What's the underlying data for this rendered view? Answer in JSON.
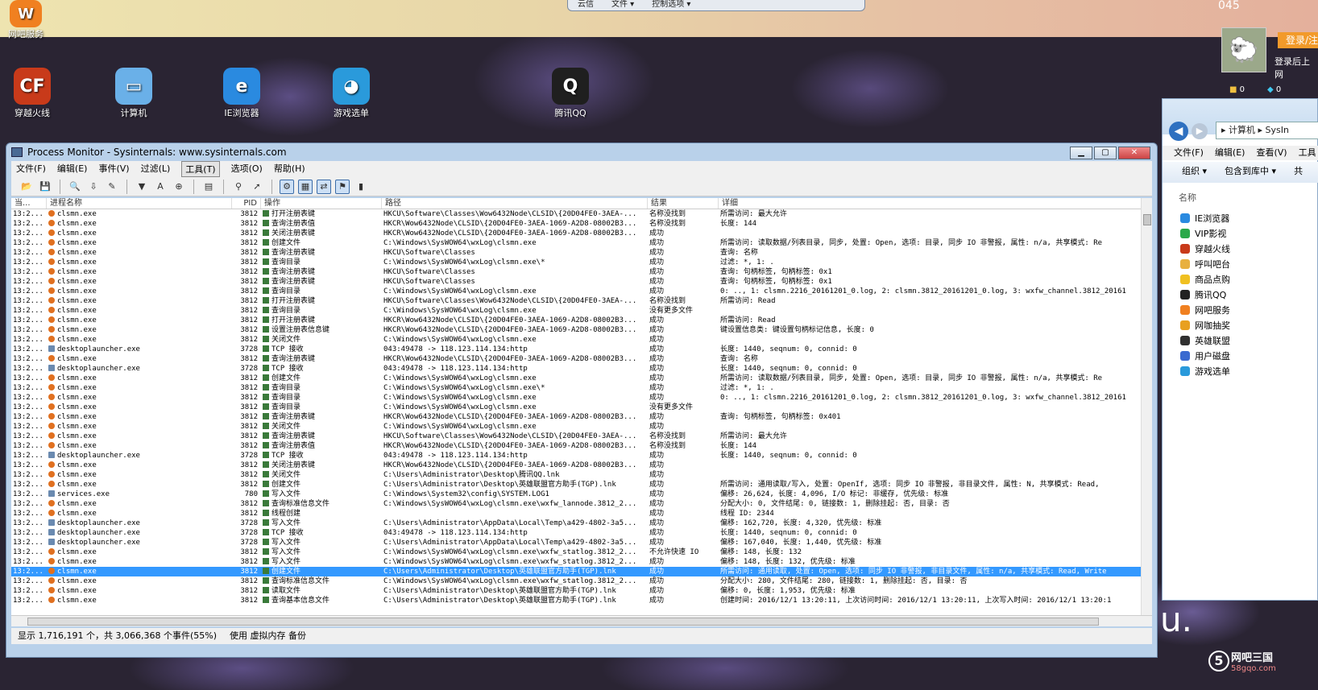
{
  "topbar": {
    "items": [
      "云信",
      "文件 ▾",
      "控制选项 ▾"
    ]
  },
  "clock": "045",
  "desktop": {
    "corner_label": "网吧服务",
    "icons": [
      {
        "label": "穿越火线",
        "icon": "crossfire-icon",
        "color": "#c83a1a",
        "glyph": "CF"
      },
      {
        "label": "计算机",
        "icon": "computer-icon",
        "color": "#6ab0e8",
        "glyph": "▭"
      },
      {
        "label": "IE浏览器",
        "icon": "ie-browser-icon",
        "color": "#2a8ae0",
        "glyph": "e"
      },
      {
        "label": "游戏选单",
        "icon": "game-menu-icon",
        "color": "#2a9adb",
        "glyph": "◕"
      },
      {
        "label": "腾讯QQ",
        "icon": "qq-penguin-icon",
        "color": "#1f1f1f",
        "glyph": "Q"
      }
    ]
  },
  "right_panel": {
    "login": "登录/注",
    "hint": "登录后上网",
    "count1": "0",
    "count2": "0"
  },
  "explorer": {
    "address": "▸ 计算机 ▸ SysIn",
    "menu": [
      "文件(F)",
      "编辑(E)",
      "查看(V)",
      "工具"
    ],
    "toolbar": [
      "组织 ▾",
      "包含到库中 ▾",
      "共"
    ],
    "column": "名称",
    "items": [
      {
        "label": "IE浏览器",
        "color": "#2a8ae0"
      },
      {
        "label": "VIP影视",
        "color": "#2aa84a"
      },
      {
        "label": "穿越火线",
        "color": "#c83a1a"
      },
      {
        "label": "呼叫吧台",
        "color": "#e8b040"
      },
      {
        "label": "商品点购",
        "color": "#f0c020"
      },
      {
        "label": "腾讯QQ",
        "color": "#222222"
      },
      {
        "label": "网吧服务",
        "color": "#f08020"
      },
      {
        "label": "网咖抽奖",
        "color": "#e8a020"
      },
      {
        "label": "英雄联盟",
        "color": "#303030"
      },
      {
        "label": "用户磁盘",
        "color": "#3a6ad0"
      },
      {
        "label": "游戏选单",
        "color": "#2a9adb"
      }
    ]
  },
  "procmon": {
    "title": "Process Monitor - Sysinternals: www.sysinternals.com",
    "menu": [
      "文件(F)",
      "编辑(E)",
      "事件(V)",
      "过滤(L)",
      "工具(T)",
      "选项(O)",
      "帮助(H)"
    ],
    "active_menu_index": 4,
    "toolbar": [
      {
        "name": "open-icon",
        "glyph": "📂"
      },
      {
        "name": "save-icon",
        "glyph": "💾"
      },
      {
        "name": "sep"
      },
      {
        "name": "capture-icon",
        "glyph": "🔍"
      },
      {
        "name": "autoscroll-icon",
        "glyph": "⇩"
      },
      {
        "name": "clear-icon",
        "glyph": "✎"
      },
      {
        "name": "sep"
      },
      {
        "name": "filter-icon",
        "glyph": "▼"
      },
      {
        "name": "highlight-icon",
        "glyph": "A"
      },
      {
        "name": "include-process-icon",
        "glyph": "⊕"
      },
      {
        "name": "sep"
      },
      {
        "name": "process-tree-icon",
        "glyph": "▤"
      },
      {
        "name": "sep"
      },
      {
        "name": "find-icon",
        "glyph": "⚲"
      },
      {
        "name": "jump-icon",
        "glyph": "➚"
      },
      {
        "name": "sep"
      },
      {
        "name": "registry-activity-icon",
        "glyph": "⚙",
        "selected": true
      },
      {
        "name": "file-activity-icon",
        "glyph": "▦",
        "selected": true
      },
      {
        "name": "network-activity-icon",
        "glyph": "⇄",
        "selected": true
      },
      {
        "name": "process-activity-icon",
        "glyph": "⚑",
        "selected": true
      },
      {
        "name": "profiling-icon",
        "glyph": "▮"
      }
    ],
    "columns": [
      "当...",
      "进程名称",
      "PID",
      "操作",
      "路径",
      "结果",
      "详细"
    ],
    "rows": [
      [
        "13:2...",
        "clsmn.exe",
        "3812",
        "打开注册表键",
        "HKCU\\Software\\Classes\\Wow6432Node\\CLSID\\{20D04FE0-3AEA-...",
        "名称没找到",
        "所需访问: 最大允许"
      ],
      [
        "13:2...",
        "clsmn.exe",
        "3812",
        "查询注册表值",
        "HKCR\\Wow6432Node\\CLSID\\{20D04FE0-3AEA-1069-A2D8-08002B3...",
        "名称没找到",
        "长度: 144"
      ],
      [
        "13:2...",
        "clsmn.exe",
        "3812",
        "关闭注册表键",
        "HKCR\\Wow6432Node\\CLSID\\{20D04FE0-3AEA-1069-A2D8-08002B3...",
        "成功",
        ""
      ],
      [
        "13:2...",
        "clsmn.exe",
        "3812",
        "创建文件",
        "C:\\Windows\\SysWOW64\\wxLog\\clsmn.exe",
        "成功",
        "所需访问: 读取数据/列表目录, 同步, 处置: Open, 选项: 目录, 同步 IO 非警报, 属性: n/a, 共享模式: Re"
      ],
      [
        "13:2...",
        "clsmn.exe",
        "3812",
        "查询注册表键",
        "HKCU\\Software\\Classes",
        "成功",
        "查询: 名称"
      ],
      [
        "13:2...",
        "clsmn.exe",
        "3812",
        "查询目录",
        "C:\\Windows\\SysWOW64\\wxLog\\clsmn.exe\\*",
        "成功",
        "过滤: *, 1: ."
      ],
      [
        "13:2...",
        "clsmn.exe",
        "3812",
        "查询注册表键",
        "HKCU\\Software\\Classes",
        "成功",
        "查询: 句柄标签, 句柄标签: 0x1"
      ],
      [
        "13:2...",
        "clsmn.exe",
        "3812",
        "查询注册表键",
        "HKCU\\Software\\Classes",
        "成功",
        "查询: 句柄标签, 句柄标签: 0x1"
      ],
      [
        "13:2...",
        "clsmn.exe",
        "3812",
        "查询目录",
        "C:\\Windows\\SysWOW64\\wxLog\\clsmn.exe",
        "成功",
        "0: .., 1: clsmn.2216_20161201_0.log, 2: clsmn.3812_20161201_0.log, 3: wxfw_channel.3812_20161"
      ],
      [
        "13:2...",
        "clsmn.exe",
        "3812",
        "打开注册表键",
        "HKCU\\Software\\Classes\\Wow6432Node\\CLSID\\{20D04FE0-3AEA-...",
        "名称没找到",
        "所需访问: Read"
      ],
      [
        "13:2...",
        "clsmn.exe",
        "3812",
        "查询目录",
        "C:\\Windows\\SysWOW64\\wxLog\\clsmn.exe",
        "没有更多文件",
        ""
      ],
      [
        "13:2...",
        "clsmn.exe",
        "3812",
        "打开注册表键",
        "HKCR\\Wow6432Node\\CLSID\\{20D04FE0-3AEA-1069-A2D8-08002B3...",
        "成功",
        "所需访问: Read"
      ],
      [
        "13:2...",
        "clsmn.exe",
        "3812",
        "设置注册表信息键",
        "HKCR\\Wow6432Node\\CLSID\\{20D04FE0-3AEA-1069-A2D8-08002B3...",
        "成功",
        "键设置信息类: 键设置句柄标记信息, 长度: 0"
      ],
      [
        "13:2...",
        "clsmn.exe",
        "3812",
        "关闭文件",
        "C:\\Windows\\SysWOW64\\wxLog\\clsmn.exe",
        "成功",
        ""
      ],
      [
        "13:2...",
        "desktoplauncher.exe",
        "3728",
        "TCP 接收",
        "043:49478 -> 118.123.114.134:http",
        "成功",
        "长度: 1440, seqnum: 0, connid: 0"
      ],
      [
        "13:2...",
        "clsmn.exe",
        "3812",
        "查询注册表键",
        "HKCR\\Wow6432Node\\CLSID\\{20D04FE0-3AEA-1069-A2D8-08002B3...",
        "成功",
        "查询: 名称"
      ],
      [
        "13:2...",
        "desktoplauncher.exe",
        "3728",
        "TCP 接收",
        "043:49478 -> 118.123.114.134:http",
        "成功",
        "长度: 1440, seqnum: 0, connid: 0"
      ],
      [
        "13:2...",
        "clsmn.exe",
        "3812",
        "创建文件",
        "C:\\Windows\\SysWOW64\\wxLog\\clsmn.exe",
        "成功",
        "所需访问: 读取数据/列表目录, 同步, 处置: Open, 选项: 目录, 同步 IO 非警报, 属性: n/a, 共享模式: Re"
      ],
      [
        "13:2...",
        "clsmn.exe",
        "3812",
        "查询目录",
        "C:\\Windows\\SysWOW64\\wxLog\\clsmn.exe\\*",
        "成功",
        "过滤: *, 1: ."
      ],
      [
        "13:2...",
        "clsmn.exe",
        "3812",
        "查询目录",
        "C:\\Windows\\SysWOW64\\wxLog\\clsmn.exe",
        "成功",
        "0: .., 1: clsmn.2216_20161201_0.log, 2: clsmn.3812_20161201_0.log, 3: wxfw_channel.3812_20161"
      ],
      [
        "13:2...",
        "clsmn.exe",
        "3812",
        "查询目录",
        "C:\\Windows\\SysWOW64\\wxLog\\clsmn.exe",
        "没有更多文件",
        ""
      ],
      [
        "13:2...",
        "clsmn.exe",
        "3812",
        "查询注册表键",
        "HKCR\\Wow6432Node\\CLSID\\{20D04FE0-3AEA-1069-A2D8-08002B3...",
        "成功",
        "查询: 句柄标签, 句柄标签: 0x401"
      ],
      [
        "13:2...",
        "clsmn.exe",
        "3812",
        "关闭文件",
        "C:\\Windows\\SysWOW64\\wxLog\\clsmn.exe",
        "成功",
        ""
      ],
      [
        "13:2...",
        "clsmn.exe",
        "3812",
        "查询注册表键",
        "HKCU\\Software\\Classes\\Wow6432Node\\CLSID\\{20D04FE0-3AEA-...",
        "名称没找到",
        "所需访问: 最大允许"
      ],
      [
        "13:2...",
        "clsmn.exe",
        "3812",
        "查询注册表值",
        "HKCR\\Wow6432Node\\CLSID\\{20D04FE0-3AEA-1069-A2D8-08002B3...",
        "名称没找到",
        "长度: 144"
      ],
      [
        "13:2...",
        "desktoplauncher.exe",
        "3728",
        "TCP 接收",
        "043:49478 -> 118.123.114.134:http",
        "成功",
        "长度: 1440, seqnum: 0, connid: 0"
      ],
      [
        "13:2...",
        "clsmn.exe",
        "3812",
        "关闭注册表键",
        "HKCR\\Wow6432Node\\CLSID\\{20D04FE0-3AEA-1069-A2D8-08002B3...",
        "成功",
        ""
      ],
      [
        "13:2...",
        "clsmn.exe",
        "3812",
        "关闭文件",
        "C:\\Users\\Administrator\\Desktop\\腾讯QQ.lnk",
        "成功",
        ""
      ],
      [
        "13:2...",
        "clsmn.exe",
        "3812",
        "创建文件",
        "C:\\Users\\Administrator\\Desktop\\英雄联盟官方助手(TGP).lnk",
        "成功",
        "所需访问: 通用读取/写入, 处置: OpenIf, 选项: 同步 IO 非警报, 非目录文件, 属性: N, 共享模式: Read,"
      ],
      [
        "13:2...",
        "services.exe",
        "780",
        "写入文件",
        "C:\\Windows\\System32\\config\\SYSTEM.LOG1",
        "成功",
        "偏移: 26,624, 长度: 4,096, I/O 标记: 非缓存, 优先级: 标准"
      ],
      [
        "13:2...",
        "clsmn.exe",
        "3812",
        "查询标准信息文件",
        "C:\\Windows\\SysWOW64\\wxLog\\clsmn.exe\\wxfw_lannode.3812_2...",
        "成功",
        "分配大小: 0, 文件结尾: 0, 链接数: 1, 删除挂起: 否, 目录: 否"
      ],
      [
        "13:2...",
        "clsmn.exe",
        "3812",
        "线程创建",
        "",
        "成功",
        "线程 ID: 2344"
      ],
      [
        "13:2...",
        "desktoplauncher.exe",
        "3728",
        "写入文件",
        "C:\\Users\\Administrator\\AppData\\Local\\Temp\\a429-4802-3a5...",
        "成功",
        "偏移: 162,720, 长度: 4,320, 优先级: 标准"
      ],
      [
        "13:2...",
        "desktoplauncher.exe",
        "3728",
        "TCP 接收",
        "043:49478 -> 118.123.114.134:http",
        "成功",
        "长度: 1440, seqnum: 0, connid: 0"
      ],
      [
        "13:2...",
        "desktoplauncher.exe",
        "3728",
        "写入文件",
        "C:\\Users\\Administrator\\AppData\\Local\\Temp\\a429-4802-3a5...",
        "成功",
        "偏移: 167,040, 长度: 1,440, 优先级: 标准"
      ],
      [
        "13:2...",
        "clsmn.exe",
        "3812",
        "写入文件",
        "C:\\Windows\\SysWOW64\\wxLog\\clsmn.exe\\wxfw_statlog.3812_2...",
        "不允许快速 IO",
        "偏移: 148, 长度: 132"
      ],
      [
        "13:2...",
        "clsmn.exe",
        "3812",
        "写入文件",
        "C:\\Windows\\SysWOW64\\wxLog\\clsmn.exe\\wxfw_statlog.3812_2...",
        "成功",
        "偏移: 148, 长度: 132, 优先级: 标准"
      ],
      [
        "13:2...",
        "clsmn.exe",
        "3812",
        "创建文件",
        "C:\\Users\\Administrator\\Desktop\\英雄联盟官方助手(TGP).lnk",
        "成功",
        "所需访问: 通用读取, 处置: Open, 选项: 同步 IO 非警报, 非目录文件, 属性: n/a, 共享模式: Read, Write"
      ],
      [
        "13:2...",
        "clsmn.exe",
        "3812",
        "查询标准信息文件",
        "C:\\Windows\\SysWOW64\\wxLog\\clsmn.exe\\wxfw_statlog.3812_2...",
        "成功",
        "分配大小: 280, 文件结尾: 280, 链接数: 1, 删除挂起: 否, 目录: 否"
      ],
      [
        "13:2...",
        "clsmn.exe",
        "3812",
        "读取文件",
        "C:\\Users\\Administrator\\Desktop\\英雄联盟官方助手(TGP).lnk",
        "成功",
        "偏移: 0, 长度: 1,953, 优先级: 标准"
      ],
      [
        "13:2...",
        "clsmn.exe",
        "3812",
        "查询基本信息文件",
        "C:\\Users\\Administrator\\Desktop\\英雄联盟官方助手(TGP).lnk",
        "成功",
        "创建时间: 2016/12/1 13:20:11, 上次访问时间: 2016/12/1 13:20:11, 上次写入时间: 2016/12/1 13:20:1"
      ]
    ],
    "selected_row": 37,
    "status": [
      "显示 1,716,191 个，共 3,066,368 个事件(55%)",
      "使用 虚拟内存 备份"
    ]
  },
  "watermark": {
    "u": "u.",
    "brand": "网吧三国",
    "site": "58gqo.com",
    "num": "5"
  }
}
